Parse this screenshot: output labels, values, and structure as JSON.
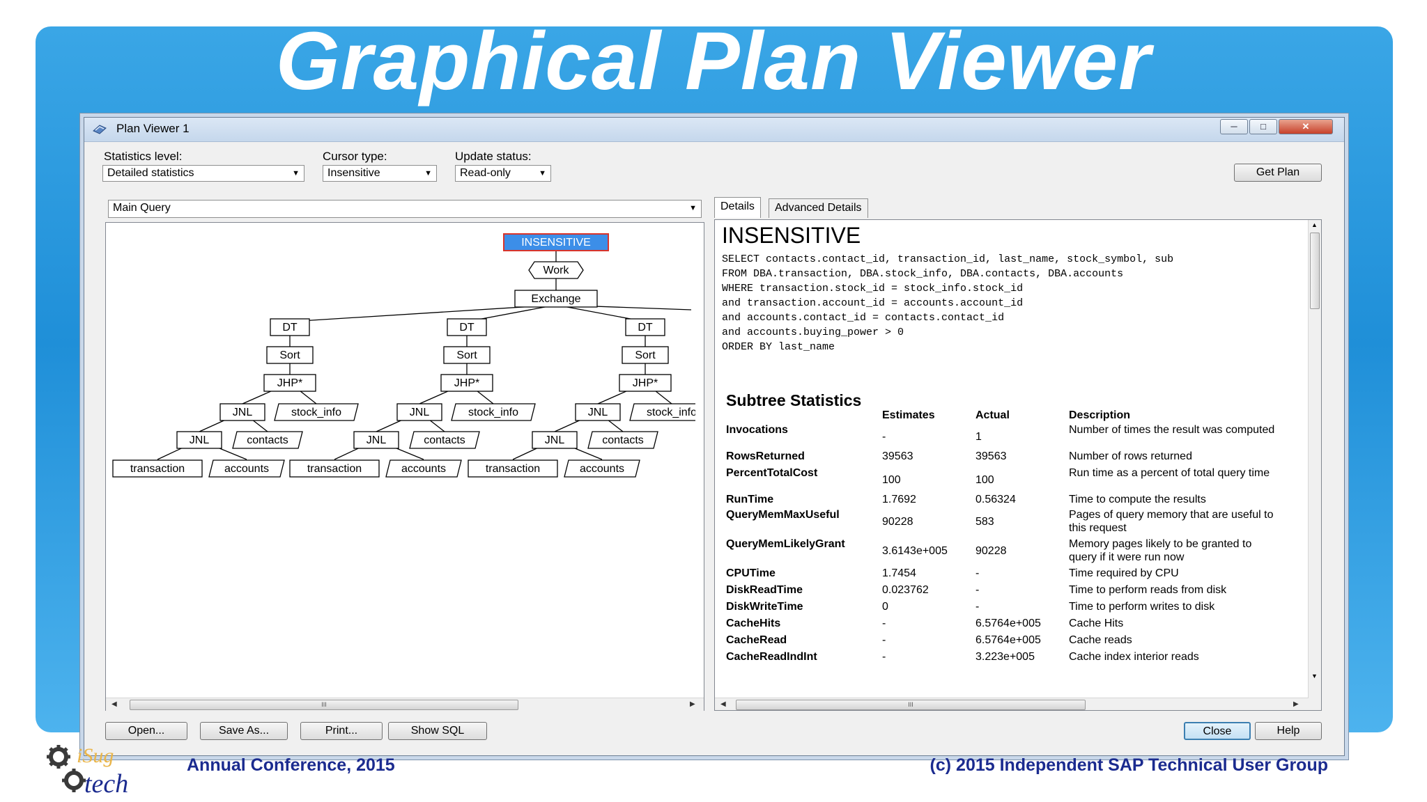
{
  "slide": {
    "title": "Graphical Plan Viewer",
    "footer_left": "Annual Conference, 2015",
    "footer_right": "(c) 2015 Independent SAP Technical User Group",
    "logo_text_top": "iSug",
    "logo_text_bottom": "tech"
  },
  "window": {
    "title": "Plan Viewer 1",
    "icon": "plan-viewer-icon",
    "controls": {
      "minimize": "minimize-icon",
      "maximize": "maximize-icon",
      "close": "close-icon"
    }
  },
  "toolbar": {
    "statistics_label": "Statistics level:",
    "statistics_value": "Detailed statistics",
    "cursor_label": "Cursor type:",
    "cursor_value": "Insensitive",
    "update_label": "Update status:",
    "update_value": "Read-only",
    "get_plan": "Get Plan"
  },
  "query_select": {
    "value": "Main Query"
  },
  "plan_tree": {
    "root": "INSENSITIVE",
    "work": "Work",
    "exchange": "Exchange",
    "branches": [
      {
        "dt": "DT",
        "sort": "Sort",
        "jhp": "JHP*",
        "jnl_upper": "JNL",
        "stock": "stock_info",
        "jnl_lower": "JNL",
        "contacts": "contacts",
        "transaction": "transaction",
        "accounts": "accounts"
      },
      {
        "dt": "DT",
        "sort": "Sort",
        "jhp": "JHP*",
        "jnl_upper": "JNL",
        "stock": "stock_info",
        "jnl_lower": "JNL",
        "contacts": "contacts",
        "transaction": "transaction",
        "accounts": "accounts"
      },
      {
        "dt": "DT",
        "sort": "Sort",
        "jhp": "JHP*",
        "jnl_upper": "JNL",
        "stock": "stock_info",
        "jnl_lower": "JNL",
        "contacts": "contacts",
        "transaction": "transaction",
        "accounts": "accounts"
      }
    ],
    "root_color": "#3c8ee8"
  },
  "tabs": [
    {
      "label": "Details"
    },
    {
      "label": "Advanced Details"
    }
  ],
  "details": {
    "heading": "INSENSITIVE",
    "sql": "SELECT contacts.contact_id, transaction_id, last_name, stock_symbol, sub\nFROM DBA.transaction, DBA.stock_info, DBA.contacts, DBA.accounts\nWHERE transaction.stock_id = stock_info.stock_id\nand transaction.account_id = accounts.account_id\nand accounts.contact_id = contacts.contact_id\nand accounts.buying_power > 0\nORDER BY last_name",
    "stats_title": "Subtree Statistics",
    "columns": {
      "estimates": "Estimates",
      "actual": "Actual",
      "description": "Description"
    },
    "rows": [
      {
        "name": "Invocations",
        "estimate": "-",
        "actual": "1",
        "description": "Number of times the result was computed"
      },
      {
        "name": "RowsReturned",
        "estimate": "39563",
        "actual": "39563",
        "description": "Number of rows returned"
      },
      {
        "name": "PercentTotalCost",
        "estimate": "100",
        "actual": "100",
        "description": "Run time as a percent of total query time"
      },
      {
        "name": "RunTime",
        "estimate": "1.7692",
        "actual": "0.56324",
        "description": "Time to compute the results"
      },
      {
        "name": "QueryMemMaxUseful",
        "estimate": "90228",
        "actual": "583",
        "description": "Pages of query memory that are useful to this request"
      },
      {
        "name": "QueryMemLikelyGrant",
        "estimate": "3.6143e+005",
        "actual": "90228",
        "description": "Memory pages likely to be granted to query if it were run now"
      },
      {
        "name": "CPUTime",
        "estimate": "1.7454",
        "actual": "-",
        "description": "Time required by CPU"
      },
      {
        "name": "DiskReadTime",
        "estimate": "0.023762",
        "actual": "-",
        "description": "Time to perform reads from disk"
      },
      {
        "name": "DiskWriteTime",
        "estimate": "0",
        "actual": "-",
        "description": "Time to perform writes to disk"
      },
      {
        "name": "CacheHits",
        "estimate": "-",
        "actual": "6.5764e+005",
        "description": "Cache Hits"
      },
      {
        "name": "CacheRead",
        "estimate": "-",
        "actual": "6.5764e+005",
        "description": "Cache reads"
      },
      {
        "name": "CacheReadIndInt",
        "estimate": "-",
        "actual": "3.223e+005",
        "description": "Cache index interior reads"
      }
    ]
  },
  "bottom_buttons": {
    "open": "Open...",
    "save_as": "Save As...",
    "print": "Print...",
    "show_sql": "Show SQL",
    "close": "Close",
    "help": "Help"
  },
  "scroll_grip": "III"
}
